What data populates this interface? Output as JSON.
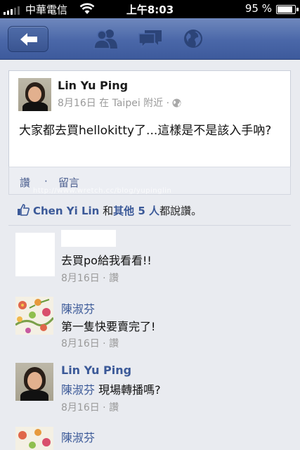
{
  "status_bar": {
    "carrier": "中華電信",
    "time": "上午8:03",
    "battery_pct": "95 %",
    "battery_level": 0.95,
    "signal_bars": 3
  },
  "nav": {
    "back_icon": "back-arrow-icon",
    "icons": [
      "friend-requests-icon",
      "messages-icon",
      "notifications-globe-icon"
    ]
  },
  "post": {
    "author": "Lin Yu Ping",
    "meta": "8月16日 在 Taipei 附近 ·",
    "meta_icon": "globe-icon",
    "text": "大家都去買hellokitty了...這樣是不是該入手吶?"
  },
  "actions": {
    "like": "讚",
    "separator": "·",
    "comment": "留言",
    "watermark": "http://www.wretch.cc/blog/yupinglin"
  },
  "likes": {
    "name": "Chen Yi Lin",
    "connector": "和",
    "others": "其他 5 人",
    "suffix": "都說讚。"
  },
  "comments": [
    {
      "name": "",
      "text": "去買po給我看看!!",
      "date": "8月16日 · 讚"
    },
    {
      "name": "陳淑芬",
      "text": "第一隻快要賣完了!",
      "date": "8月16日 · 讚"
    },
    {
      "name": "Lin Yu Ping",
      "tag": "陳淑芬",
      "text": "現場轉播嗎?",
      "date": "8月16日 · 讚"
    },
    {
      "name": "陳淑芬",
      "text": "",
      "date": ""
    }
  ],
  "colors": {
    "fb_blue": "#3b5998",
    "nav_top": "#6f88bd",
    "nav_bottom": "#3d5a9c",
    "background": "#e9ebf0"
  }
}
